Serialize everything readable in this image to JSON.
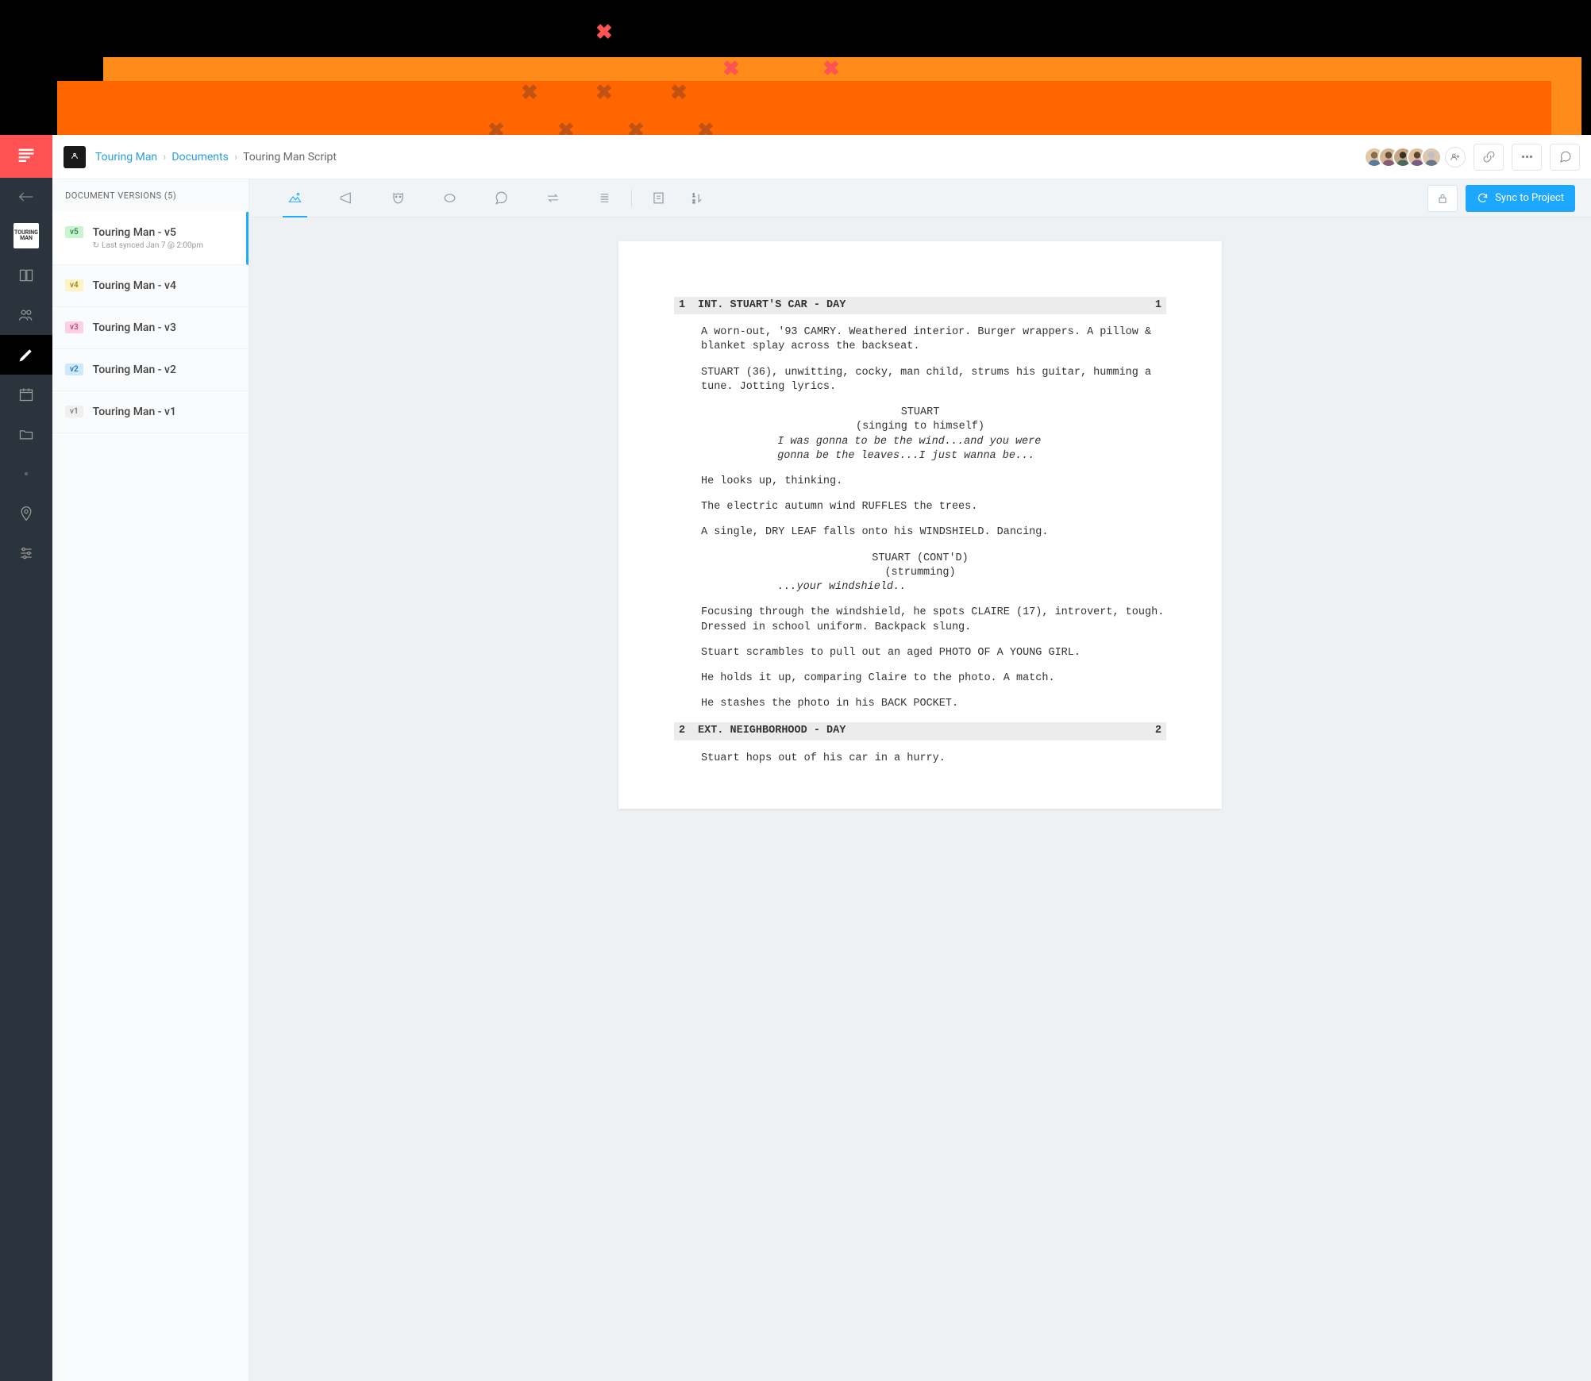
{
  "breadcrumb": {
    "project": "Touring Man",
    "section": "Documents",
    "current": "Touring Man Script"
  },
  "rail": {
    "thumb_label": "TOURING MAN"
  },
  "versions_panel": {
    "header": "DOCUMENT VERSIONS (5)",
    "items": [
      {
        "badge": "v5",
        "badge_class": "vb-5",
        "title": "Touring Man - v5",
        "meta": "Last synced Jan 7 @ 2:00pm",
        "active": true
      },
      {
        "badge": "v4",
        "badge_class": "vb-4",
        "title": "Touring Man - v4"
      },
      {
        "badge": "v3",
        "badge_class": "vb-3",
        "title": "Touring Man - v3"
      },
      {
        "badge": "v2",
        "badge_class": "vb-2",
        "title": "Touring Man - v2"
      },
      {
        "badge": "v1",
        "badge_class": "vb-1",
        "title": "Touring Man - v1"
      }
    ]
  },
  "toolbar": {
    "sync_label": "Sync to Project",
    "numbering_label": "1\n2"
  },
  "script": {
    "scenes": [
      {
        "num": "1",
        "slug": "INT. STUART'S CAR - DAY",
        "blocks": [
          {
            "t": "action",
            "text": "A worn-out, '93 CAMRY. Weathered interior. Burger wrappers. A pillow & blanket splay across the backseat."
          },
          {
            "t": "action",
            "text": "STUART (36), unwitting, cocky, man child, strums his guitar, humming a tune. Jotting lyrics."
          },
          {
            "t": "char",
            "text": "STUART"
          },
          {
            "t": "paren",
            "text": "(singing to himself)"
          },
          {
            "t": "dialogue",
            "text": "I was gonna to be the wind...and you were gonna be the leaves...I just wanna be..."
          },
          {
            "t": "action",
            "text": "He looks up, thinking."
          },
          {
            "t": "action",
            "text": "The electric autumn wind RUFFLES the trees."
          },
          {
            "t": "action",
            "text": "A single, DRY LEAF falls onto his WINDSHIELD. Dancing."
          },
          {
            "t": "char",
            "text": "STUART (CONT'D)"
          },
          {
            "t": "paren",
            "text": "(strumming)"
          },
          {
            "t": "dialogue",
            "text": "...your windshield.."
          },
          {
            "t": "action",
            "text": "Focusing through the windshield, he spots CLAIRE (17), introvert, tough. Dressed in school uniform. Backpack slung."
          },
          {
            "t": "action",
            "text": "Stuart scrambles to pull out an aged PHOTO OF A YOUNG GIRL."
          },
          {
            "t": "action",
            "text": "He holds it up, comparing Claire to the photo. A match."
          },
          {
            "t": "action",
            "text": "He stashes the photo in his BACK POCKET."
          }
        ]
      },
      {
        "num": "2",
        "slug": "EXT. NEIGHBORHOOD - DAY",
        "blocks": [
          {
            "t": "action",
            "text": "Stuart hops out of his car in a hurry."
          }
        ]
      }
    ]
  }
}
